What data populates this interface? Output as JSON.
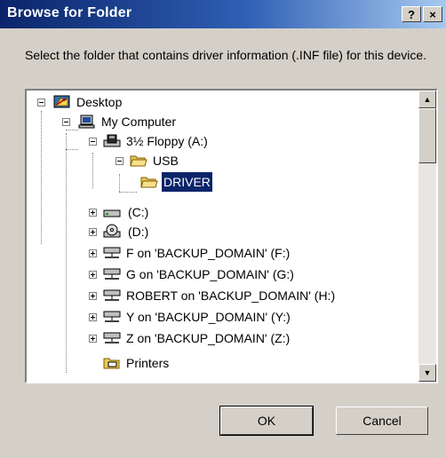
{
  "window": {
    "title": "Browse for Folder",
    "help_label": "?",
    "close_label": "×"
  },
  "instruction": "Select the folder that contains driver information (.INF file) for this device.",
  "tree": {
    "items": [
      {
        "label": "Desktop",
        "icon": "desktop-icon",
        "expander": "minus"
      },
      {
        "label": "My Computer",
        "icon": "computer-icon",
        "expander": "minus"
      },
      {
        "label": "3½ Floppy (A:)",
        "icon": "floppy-drive-icon",
        "expander": "minus"
      },
      {
        "label": "USB",
        "icon": "open-folder-icon",
        "expander": "minus"
      },
      {
        "label": "DRIVER",
        "icon": "open-folder-icon",
        "expander": "",
        "selected": true
      },
      {
        "label": "(C:)",
        "icon": "hard-drive-icon",
        "expander": "plus"
      },
      {
        "label": "(D:)",
        "icon": "cd-drive-icon",
        "expander": "plus"
      },
      {
        "label": "F on 'BACKUP_DOMAIN' (F:)",
        "icon": "network-drive-icon",
        "expander": "plus"
      },
      {
        "label": "G on 'BACKUP_DOMAIN' (G:)",
        "icon": "network-drive-icon",
        "expander": "plus"
      },
      {
        "label": "ROBERT on 'BACKUP_DOMAIN' (H:)",
        "icon": "network-drive-icon",
        "expander": "plus"
      },
      {
        "label": "Y on 'BACKUP_DOMAIN' (Y:)",
        "icon": "network-drive-icon",
        "expander": "plus"
      },
      {
        "label": "Z on 'BACKUP_DOMAIN' (Z:)",
        "icon": "network-drive-icon",
        "expander": "plus"
      },
      {
        "label": "Printers",
        "icon": "printers-folder-icon",
        "expander": ""
      }
    ]
  },
  "buttons": {
    "ok": "OK",
    "cancel": "Cancel"
  },
  "colors": {
    "selection": "#0a246a",
    "dialog_face": "#d4d0c8",
    "title_start": "#0a246a",
    "title_end": "#a6caf0"
  }
}
